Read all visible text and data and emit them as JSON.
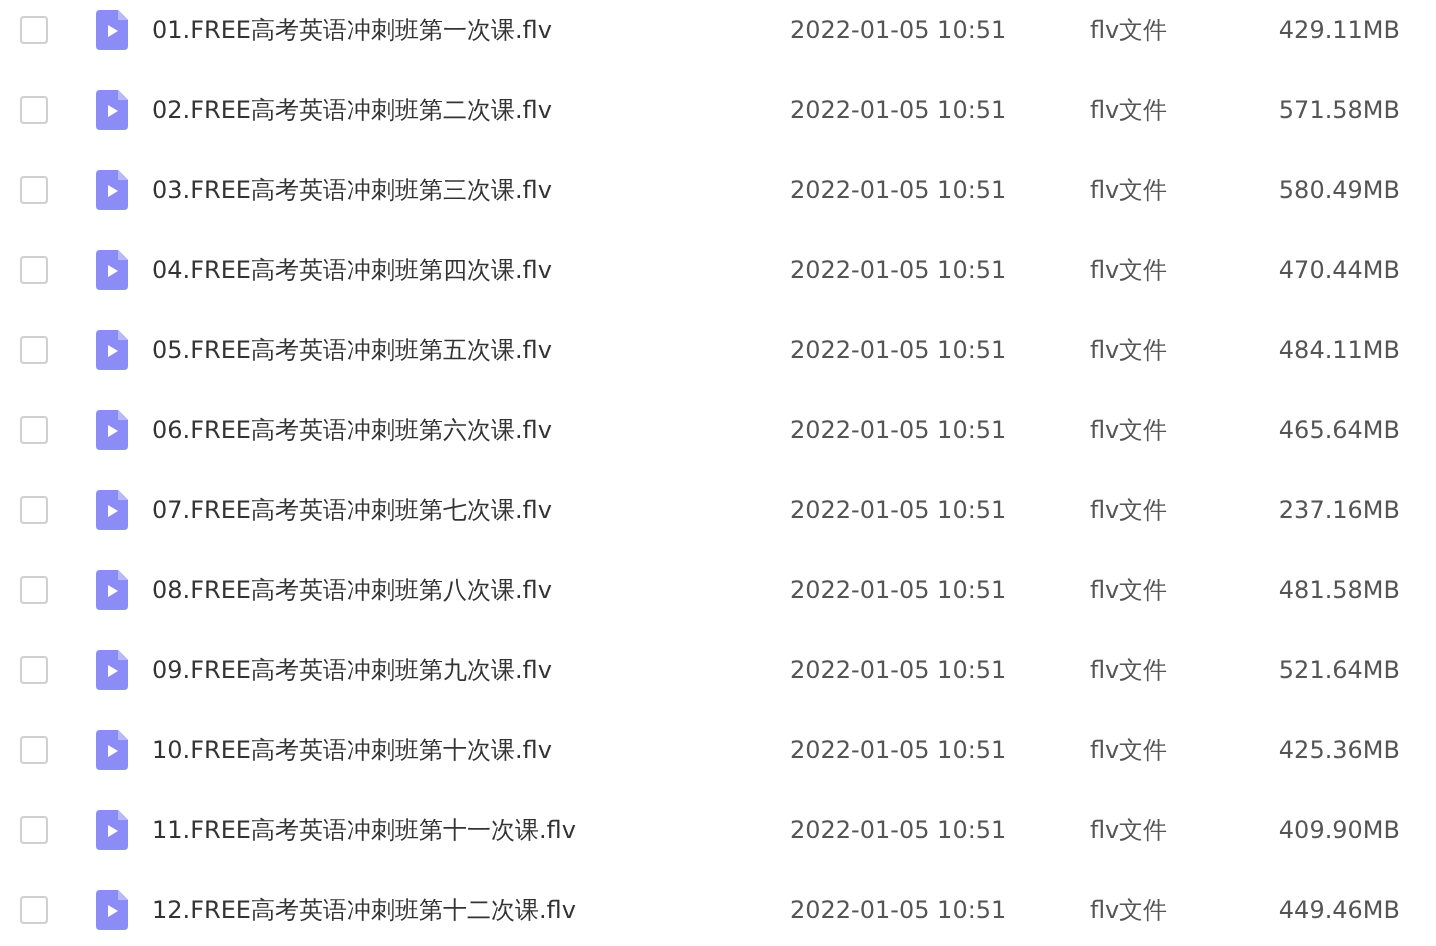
{
  "files": [
    {
      "checked": false,
      "name": "01.FREE高考英语冲刺班第一次课.flv",
      "modified": "2022-01-05 10:51",
      "type": "flv文件",
      "size": "429.11MB"
    },
    {
      "checked": false,
      "name": "02.FREE高考英语冲刺班第二次课.flv",
      "modified": "2022-01-05 10:51",
      "type": "flv文件",
      "size": "571.58MB"
    },
    {
      "checked": false,
      "name": "03.FREE高考英语冲刺班第三次课.flv",
      "modified": "2022-01-05 10:51",
      "type": "flv文件",
      "size": "580.49MB"
    },
    {
      "checked": false,
      "name": "04.FREE高考英语冲刺班第四次课.flv",
      "modified": "2022-01-05 10:51",
      "type": "flv文件",
      "size": "470.44MB"
    },
    {
      "checked": false,
      "name": "05.FREE高考英语冲刺班第五次课.flv",
      "modified": "2022-01-05 10:51",
      "type": "flv文件",
      "size": "484.11MB"
    },
    {
      "checked": false,
      "name": "06.FREE高考英语冲刺班第六次课.flv",
      "modified": "2022-01-05 10:51",
      "type": "flv文件",
      "size": "465.64MB"
    },
    {
      "checked": false,
      "name": "07.FREE高考英语冲刺班第七次课.flv",
      "modified": "2022-01-05 10:51",
      "type": "flv文件",
      "size": "237.16MB"
    },
    {
      "checked": false,
      "name": "08.FREE高考英语冲刺班第八次课.flv",
      "modified": "2022-01-05 10:51",
      "type": "flv文件",
      "size": "481.58MB"
    },
    {
      "checked": false,
      "name": "09.FREE高考英语冲刺班第九次课.flv",
      "modified": "2022-01-05 10:51",
      "type": "flv文件",
      "size": "521.64MB"
    },
    {
      "checked": false,
      "name": "10.FREE高考英语冲刺班第十次课.flv",
      "modified": "2022-01-05 10:51",
      "type": "flv文件",
      "size": "425.36MB"
    },
    {
      "checked": false,
      "name": "11.FREE高考英语冲刺班第十一次课.flv",
      "modified": "2022-01-05 10:51",
      "type": "flv文件",
      "size": "409.90MB"
    },
    {
      "checked": false,
      "name": "12.FREE高考英语冲刺班第十二次课.flv",
      "modified": "2022-01-05 10:51",
      "type": "flv文件",
      "size": "449.46MB"
    }
  ]
}
